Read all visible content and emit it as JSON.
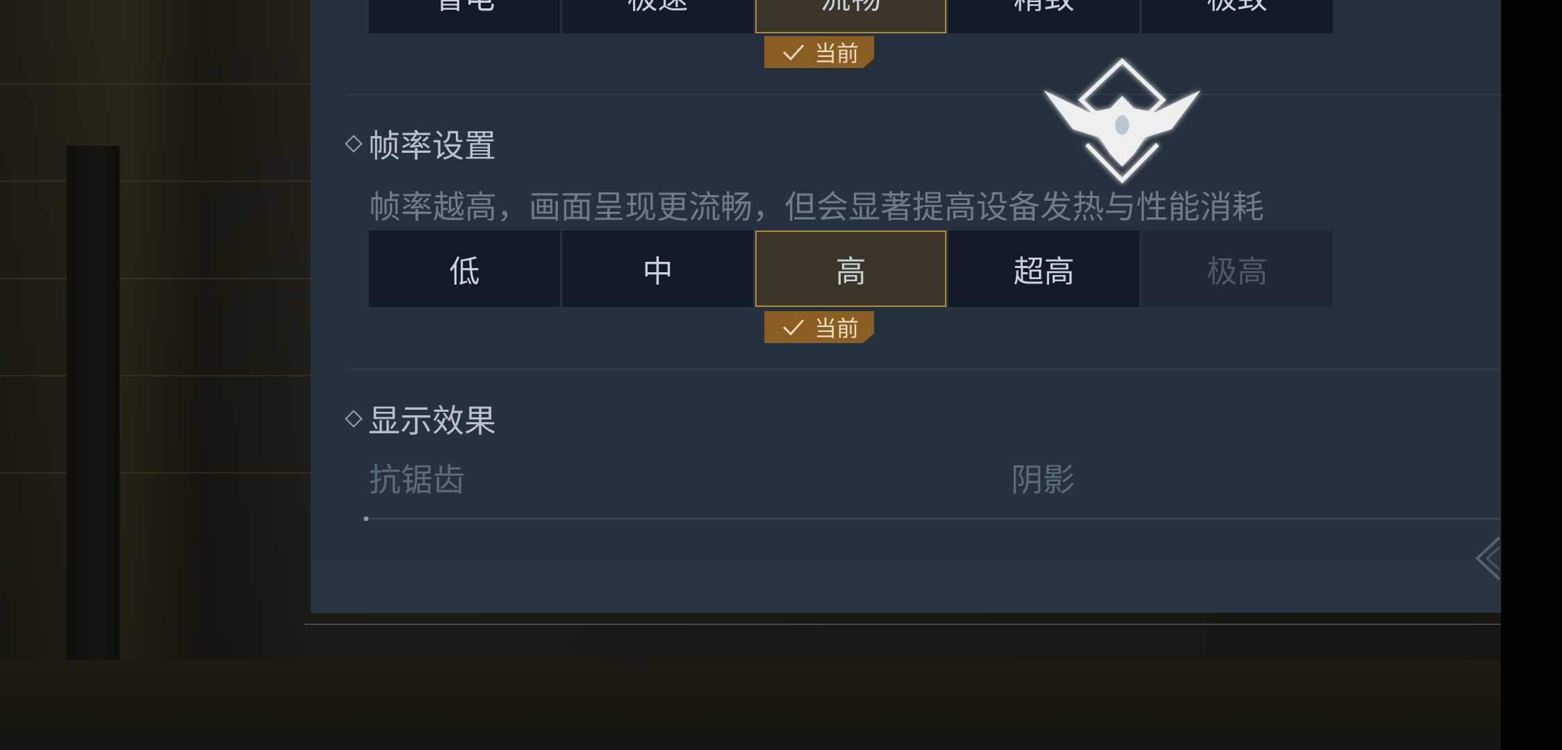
{
  "top_row": {
    "options": [
      "省电",
      "极速",
      "流畅",
      "精致",
      "极致"
    ],
    "selected_index": 2,
    "current_tag": "当前"
  },
  "frame_rate": {
    "title": "帧率设置",
    "description": "帧率越高，画面呈现更流畅，但会显著提高设备发热与性能消耗",
    "options": [
      "低",
      "中",
      "高",
      "超高",
      "极高"
    ],
    "selected_index": 2,
    "disabled_index": 4,
    "current_tag": "当前"
  },
  "display_effects": {
    "title": "显示效果",
    "anti_aliasing_label": "抗锯齿",
    "shadow_label": "阴影"
  },
  "colors": {
    "panel": "#26313e",
    "accent": "#b78a3a",
    "tag": "#8a5e22"
  }
}
